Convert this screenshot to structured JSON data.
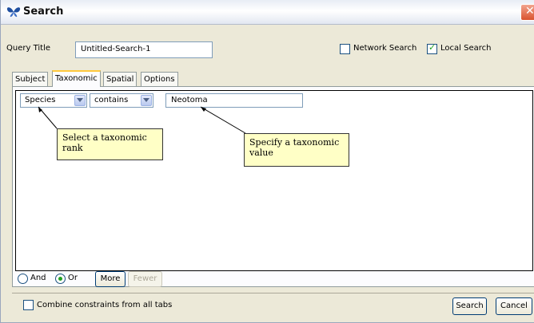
{
  "window": {
    "title": "Search",
    "app_icon": "butterfly-icon",
    "close_icon": "close-icon"
  },
  "query": {
    "label": "Query Title",
    "value": "Untitled-Search-1"
  },
  "scope": {
    "network_label": "Network Search",
    "network_checked": false,
    "local_label": "Local Search",
    "local_checked": true
  },
  "tabs": [
    {
      "label": "Subject",
      "active": false
    },
    {
      "label": "Taxonomic",
      "active": true
    },
    {
      "label": "Spatial",
      "active": false
    },
    {
      "label": "Options",
      "active": false
    }
  ],
  "constraint": {
    "rank": "Species",
    "operator": "contains",
    "value": "Neotoma"
  },
  "callouts": {
    "rank": "Select a taxonomic rank",
    "value": "Specify a taxonomic value"
  },
  "logic": {
    "and_label": "And",
    "or_label": "Or",
    "selected": "Or"
  },
  "buttons": {
    "more": "More",
    "fewer": "Fewer",
    "search": "Search",
    "cancel": "Cancel"
  },
  "combine": {
    "label": "Combine constraints from all tabs",
    "checked": false
  },
  "colors": {
    "accent_check": "#21a121",
    "callout_bg": "#ffffc6",
    "active_tab": "#ffc83c"
  }
}
